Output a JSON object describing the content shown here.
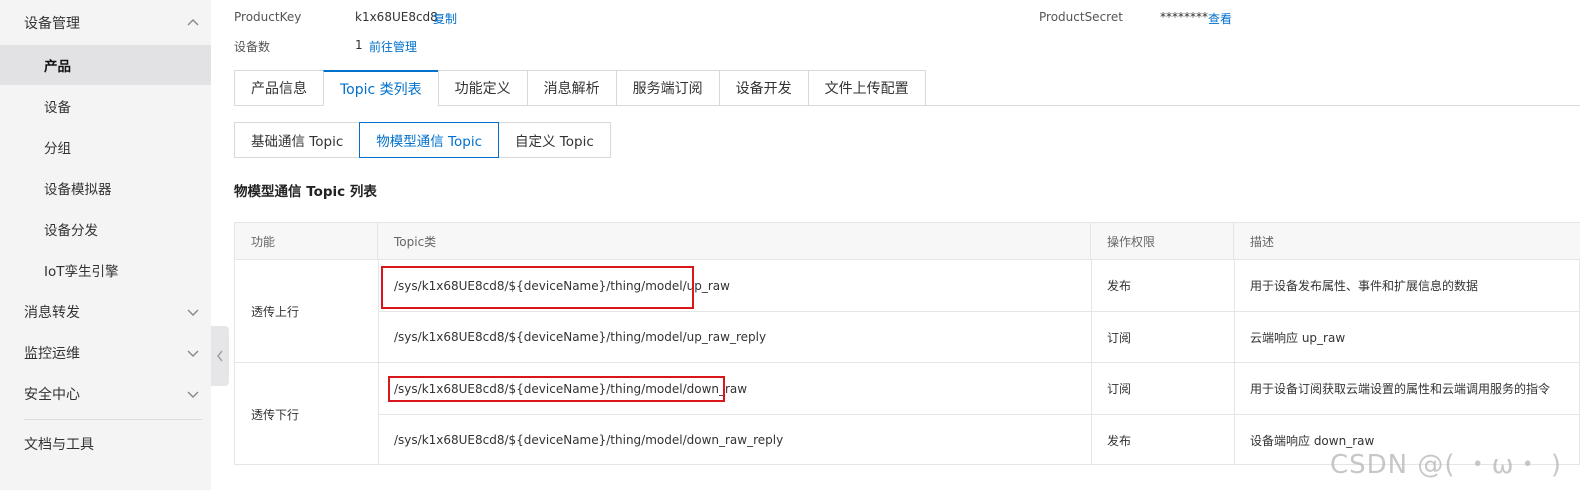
{
  "sidebar": {
    "device_mgmt": "设备管理",
    "items": [
      "产品",
      "设备",
      "分组",
      "设备模拟器",
      "设备分发",
      "IoT孪生引擎"
    ],
    "msg_forward": "消息转发",
    "monitor": "监控运维",
    "security": "安全中心",
    "docs": "文档与工具"
  },
  "info": {
    "product_key_label": "ProductKey",
    "product_key_value": "k1x68UE8cd8",
    "copy_link": "复制",
    "product_secret_label": "ProductSecret",
    "product_secret_value": "********",
    "view_link": "查看",
    "device_count_label": "设备数",
    "device_count_value": "1",
    "manage_link": "前往管理"
  },
  "tabs": [
    "产品信息",
    "Topic 类列表",
    "功能定义",
    "消息解析",
    "服务端订阅",
    "设备开发",
    "文件上传配置"
  ],
  "subtabs": [
    "基础通信 Topic",
    "物模型通信 Topic",
    "自定义 Topic"
  ],
  "section_title": "物模型通信 Topic 列表",
  "table": {
    "headers": [
      "功能",
      "Topic类",
      "操作权限",
      "描述"
    ],
    "groups": [
      {
        "function": "透传上行",
        "rows": [
          {
            "topic": "/sys/k1x68UE8cd8/${deviceName}/thing/model/up_raw",
            "permission": "发布",
            "desc": "用于设备发布属性、事件和扩展信息的数据"
          },
          {
            "topic": "/sys/k1x68UE8cd8/${deviceName}/thing/model/up_raw_reply",
            "permission": "订阅",
            "desc": "云端响应 up_raw"
          }
        ]
      },
      {
        "function": "透传下行",
        "rows": [
          {
            "topic": "/sys/k1x68UE8cd8/${deviceName}/thing/model/down_raw",
            "permission": "订阅",
            "desc": "用于设备订阅获取云端设置的属性和云端调用服务的指令"
          },
          {
            "topic": "/sys/k1x68UE8cd8/${deviceName}/thing/model/down_raw_reply",
            "permission": "发布",
            "desc": "设备端响应 down_raw"
          }
        ]
      }
    ]
  },
  "watermark": "CSDN @(  ・ω・ )"
}
